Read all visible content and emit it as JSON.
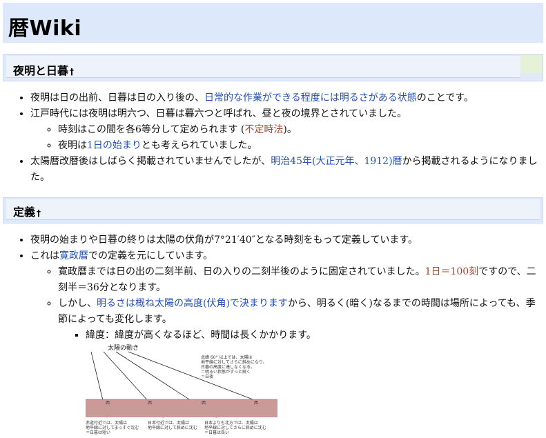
{
  "site": {
    "title": "暦Wiki"
  },
  "sections": [
    {
      "heading": "夜明と日暮",
      "anchor": "†"
    },
    {
      "heading": "定義",
      "anchor": "†"
    }
  ],
  "s1": {
    "i1": {
      "pre": "夜明は日の出前、日暮は日の入り後の、",
      "link": "日常的な作業ができる程度には明るさがある状態",
      "post": "のことです。"
    },
    "i2": {
      "text": "江戸時代には夜明は明六つ、日暮は暮六つと呼ばれ、昼と夜の境界とされていました。"
    },
    "i2a": {
      "pre": "時刻はこの間を各6等分して定められます (",
      "link": "不定時法",
      "post": ")。"
    },
    "i2b": {
      "pre": "夜明は",
      "link": "1日の始まり",
      "post": "とも考えられていました。"
    },
    "i3": {
      "pre": "太陽暦改暦後はしばらく掲載されていませんでしたが、",
      "link": "明治45年(大正元年、1912)暦",
      "post": "から掲載されるようになりました。"
    }
  },
  "s2": {
    "i1": {
      "text": "夜明の始まりや日暮の終りは太陽の伏角が7°21′40″となる時刻をもって定義しています。"
    },
    "i2": {
      "pre": "これは",
      "link": "寛政暦",
      "post": "での定義を元にしています。"
    },
    "i2a": {
      "pre": "寛政暦までは日の出の二刻半前、日の入りの二刻半後のように固定されていました。",
      "link": "1日＝100刻",
      "post": "ですので、二刻半＝36分となります。"
    },
    "i2b": {
      "pre": "しかし、",
      "link": "明るさは概ね太陽の高度(伏角)で決まります",
      "post": "から、明るく(暗く)なるまでの時間は場所によっても、季節によっても変化します。"
    },
    "i2b1": {
      "text": "緯度：緯度が高くなるほど、時間は長くかかります。"
    }
  },
  "diagram": {
    "title": "太陽の動き",
    "west_label": "西",
    "note_high": [
      "北緯 60° 以上では、太陽は",
      "地平線に対してさらに斜めになり、",
      "日暮の高度に達しなくなる。",
      "＝明るい状態がずっと続く",
      "＝白夜"
    ],
    "note_equator": [
      "赤道付近では、太陽は",
      "地平線に対してまっすぐ沈む",
      "＝日暮は短い"
    ],
    "note_japan": [
      "日本付近では、太陽は",
      "地平線に対して斜めに沈む"
    ],
    "note_north": [
      "日本よりも北方では、太陽は",
      "地平線に対してさらに斜めに沈む",
      "＝日暮は長い"
    ]
  }
}
